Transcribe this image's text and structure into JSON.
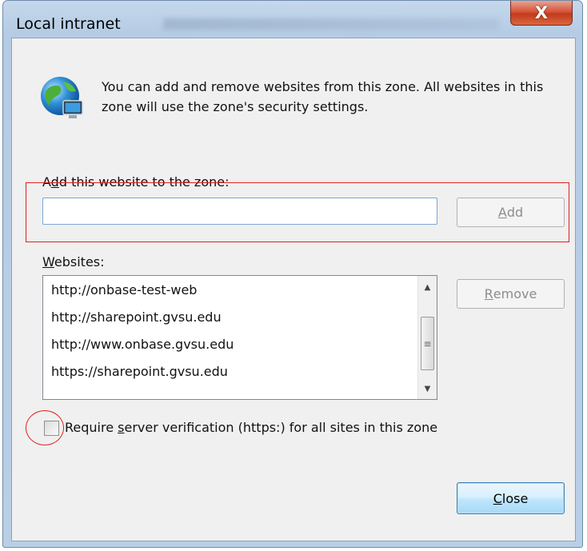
{
  "window": {
    "title": "Local intranet",
    "close_glyph": "X"
  },
  "dialog": {
    "info_text": "You can add and remove websites from this zone. All websites in this zone will use the zone's security settings.",
    "add_label_prefix": "A",
    "add_label_mnemonic": "d",
    "add_label_rest": "d this website to the zone:",
    "add_input_value": "",
    "add_button_mnemonic": "A",
    "add_button_rest": "dd",
    "websites_label_mnemonic": "W",
    "websites_label_rest": "ebsites:",
    "websites": [
      "http://onbase-test-web",
      "http://sharepoint.gvsu.edu",
      "http://www.onbase.gvsu.edu",
      "https://sharepoint.gvsu.edu"
    ],
    "remove_button_mnemonic": "R",
    "remove_button_rest": "emove",
    "require_label_prefix": "Require ",
    "require_label_mnemonic": "s",
    "require_label_rest": "erver verification (https:) for all sites in this zone",
    "require_checked": false,
    "close_button_mnemonic": "C",
    "close_button_rest": "lose"
  },
  "colors": {
    "annotation": "#e02020",
    "accent": "#3c7fb1"
  },
  "icons": {
    "zone_icon": "globe-monitor-icon",
    "scroll_up": "arrow-up-icon",
    "scroll_down": "arrow-down-icon"
  }
}
